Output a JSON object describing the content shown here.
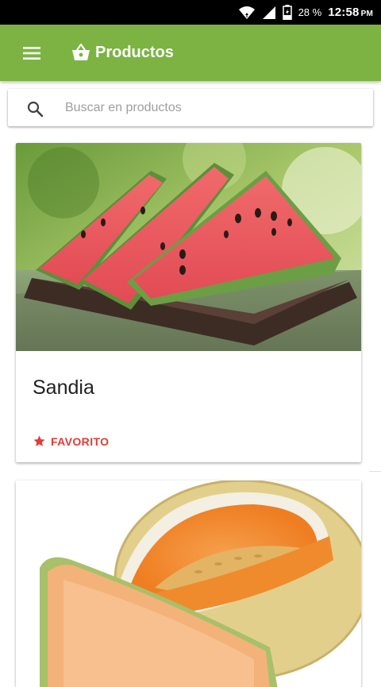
{
  "status_bar": {
    "battery_percent": "28 %",
    "time": "12:58",
    "ampm": "PM",
    "icons": [
      "wifi-icon",
      "signal-icon",
      "battery-icon"
    ]
  },
  "app_bar": {
    "title": "Productos",
    "menu_icon": "menu-icon",
    "title_icon": "basket-icon",
    "color": "#7cb342"
  },
  "search": {
    "placeholder": "Buscar en productos",
    "value": ""
  },
  "products": [
    {
      "name": "Sandia",
      "favorite_label": "FAVORITO",
      "image": "watermelon-slices"
    },
    {
      "name": "",
      "image": "cantaloupe-melon"
    }
  ],
  "colors": {
    "accent": "#e53935",
    "primary": "#7cb342"
  }
}
